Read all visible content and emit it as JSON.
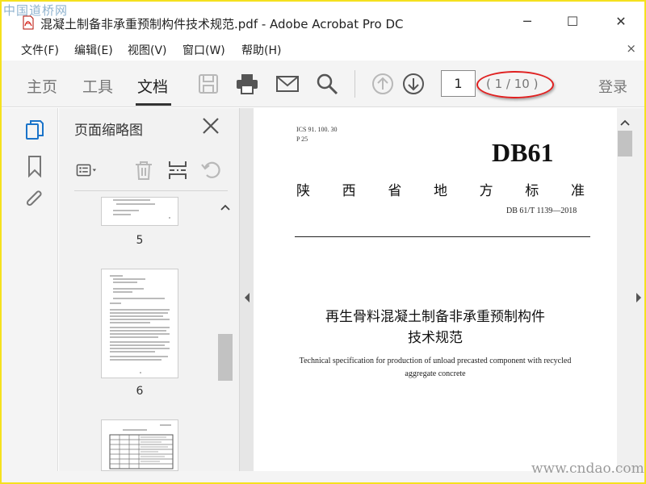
{
  "watermark_logo": "中国道桥网",
  "watermark_url": "www.cndao.com",
  "window": {
    "title": "混凝土制备非承重预制构件技术规范.pdf - Adobe Acrobat Pro DC",
    "min_glyph": "─",
    "max_glyph": "☐",
    "close_glyph": "✕"
  },
  "menu": {
    "items": [
      "文件(F)",
      "编辑(E)",
      "视图(V)",
      "窗口(W)",
      "帮助(H)"
    ],
    "close_glyph": "×"
  },
  "toolbar": {
    "tabs": [
      "主页",
      "工具",
      "文档"
    ],
    "active_tab": "文档",
    "page_input_value": "1",
    "page_count": "( 1 / 10 )",
    "login": "登录",
    "annotation_color": "#e02020"
  },
  "thumbnails": {
    "title": "页面缩略图",
    "pages": [
      {
        "label": "5"
      },
      {
        "label": "6"
      }
    ]
  },
  "document": {
    "ics": "ICS   91. 100. 30",
    "p": "P  25",
    "code": "DB61",
    "province_standard": [
      "陕",
      "西",
      "省",
      "地",
      "方",
      "标",
      "准"
    ],
    "std_no": "DB 61/T 1139—2018",
    "title_line1": "再生骨料混凝土制备非承重预制构件",
    "title_line2": "技术规范",
    "en_line1": "Technical specification for production of unload precasted component with recycled",
    "en_line2": "aggregate concrete"
  },
  "icons": {
    "toolbar": [
      "save-icon",
      "print-icon",
      "email-icon",
      "search-icon",
      "prev-page-icon",
      "next-page-icon"
    ],
    "rail": [
      "page-thumbnails-icon",
      "bookmark-icon",
      "attachment-icon"
    ],
    "panel": [
      "options-icon",
      "delete-icon",
      "insert-icon",
      "undo-icon"
    ]
  }
}
